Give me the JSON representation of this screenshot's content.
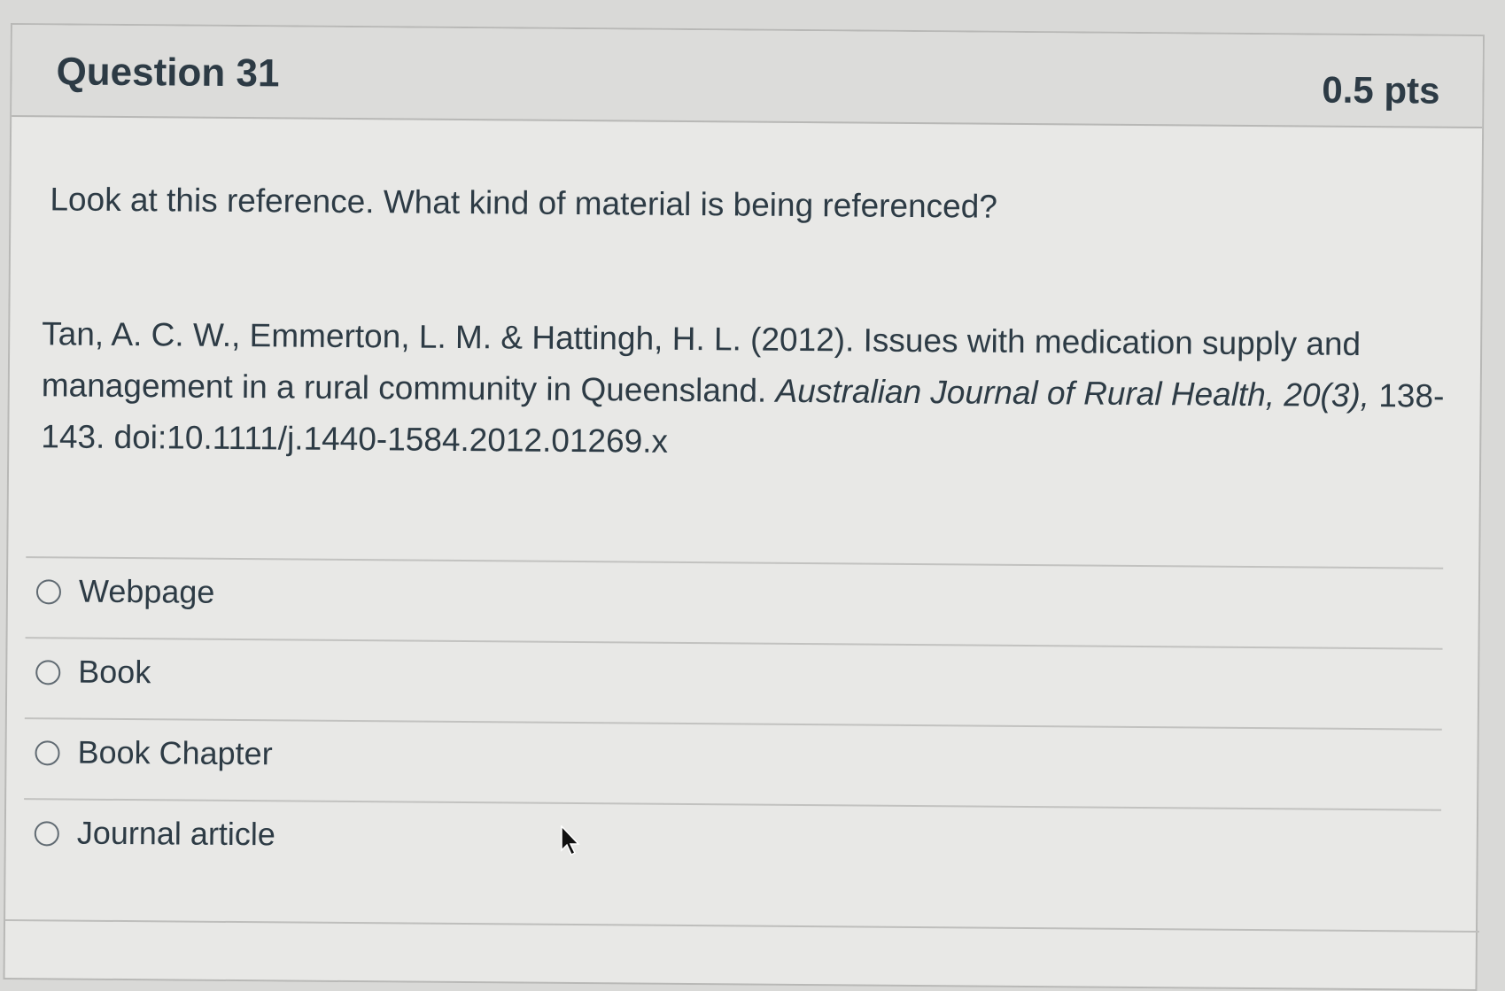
{
  "question": {
    "title": "Question 31",
    "points": "0.5 pts",
    "prompt": "Look at this reference. What kind of material is being referenced?",
    "reference": {
      "authors_and_title": "Tan, A. C. W., Emmerton, L. M. & Hattingh, H. L. (2012). Issues with medication supply and management in a rural community in Queensland. ",
      "journal": "Australian Journal of Rural Health, 20(3),",
      "pages_doi": " 138-143. doi:10.1111/j.1440-1584.2012.01269.x"
    },
    "answers": [
      {
        "label": "Webpage",
        "selected": false
      },
      {
        "label": "Book",
        "selected": false
      },
      {
        "label": "Book Chapter",
        "selected": false
      },
      {
        "label": "Journal article",
        "selected": false
      }
    ]
  }
}
